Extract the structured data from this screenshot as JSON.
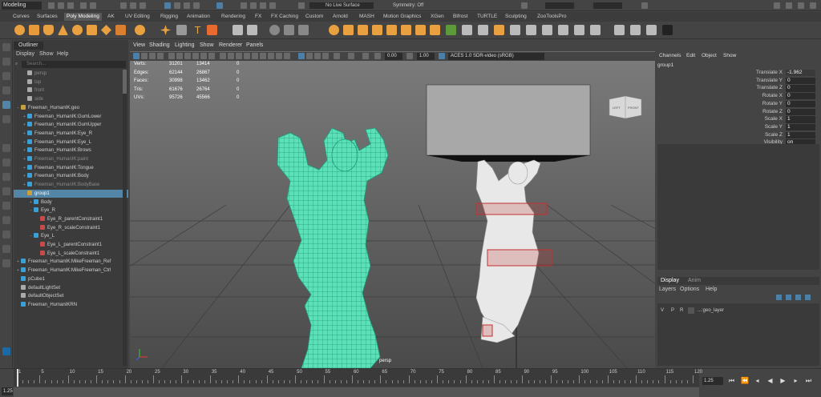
{
  "status": {
    "menuset": "Modeling",
    "surface": "No Live Surface",
    "symmetry": "Symmetry: Off",
    "field1": "",
    "field2": ""
  },
  "shelf_tabs": [
    "Curves",
    "Surfaces",
    "Poly Modeling",
    "AK",
    "UV Editing",
    "Rigging",
    "Animation",
    "Rendering",
    "FX",
    "FX Caching",
    "Custom",
    "Arnold",
    "MASH",
    "Motion Graphics",
    "XGen",
    "Bifrost",
    "TURTLE",
    "Sculpting",
    "ZooToolsPro"
  ],
  "shelf_active": "Poly Modeling",
  "outliner": {
    "title": "Outliner",
    "menu": [
      "Display",
      "Show",
      "Help"
    ],
    "search_placeholder": "Search...",
    "rows": [
      {
        "label": "persp",
        "type": "cam",
        "depth": 1,
        "grey": true
      },
      {
        "label": "top",
        "type": "cam",
        "depth": 1,
        "grey": true
      },
      {
        "label": "front",
        "type": "cam",
        "depth": 1,
        "grey": true
      },
      {
        "label": "side",
        "type": "cam",
        "depth": 1,
        "grey": true
      },
      {
        "label": "Freeman_HumanIK:geo",
        "type": "grp",
        "depth": 0,
        "exp": "−"
      },
      {
        "label": "Freeman_HumanIK:GumLower",
        "type": "mesh",
        "depth": 1,
        "exp": "+"
      },
      {
        "label": "Freeman_HumanIK:GumUpper",
        "type": "mesh",
        "depth": 1,
        "exp": "+"
      },
      {
        "label": "Freeman_HumanIK:Eye_R",
        "type": "mesh",
        "depth": 1,
        "exp": "+"
      },
      {
        "label": "Freeman_HumanIK:Eye_L",
        "type": "mesh",
        "depth": 1,
        "exp": "+"
      },
      {
        "label": "Freeman_HumanIK:Brows",
        "type": "mesh",
        "depth": 1,
        "exp": "+"
      },
      {
        "label": "Freeman_HumanIK:paint",
        "type": "mesh",
        "depth": 1,
        "exp": "+",
        "grey": true
      },
      {
        "label": "Freeman_HumanIK:Tongue",
        "type": "mesh",
        "depth": 1,
        "exp": "+"
      },
      {
        "label": "Freeman_HumanIK:Body",
        "type": "mesh",
        "depth": 1,
        "exp": "+"
      },
      {
        "label": "Freeman_HumanIK:BodyBase",
        "type": "mesh",
        "depth": 1,
        "exp": "+",
        "grey": true
      },
      {
        "label": "group1",
        "type": "grp",
        "depth": 1,
        "exp": "−",
        "sel": true
      },
      {
        "label": "Body",
        "type": "mesh",
        "depth": 2,
        "exp": "+"
      },
      {
        "label": "Eye_R",
        "type": "mesh",
        "depth": 2,
        "exp": "−"
      },
      {
        "label": "Eye_R_parentConstraint1",
        "type": "con",
        "depth": 3
      },
      {
        "label": "Eye_R_scaleConstraint1",
        "type": "con",
        "depth": 3
      },
      {
        "label": "Eye_L",
        "type": "mesh",
        "depth": 2,
        "exp": "−"
      },
      {
        "label": "Eye_L_parentConstraint1",
        "type": "con",
        "depth": 3
      },
      {
        "label": "Eye_L_scaleConstraint1",
        "type": "con",
        "depth": 3
      },
      {
        "label": "Freeman_HumanIK:MikeFreeman_Ref",
        "type": "mesh",
        "depth": 0,
        "exp": "+"
      },
      {
        "label": "Freeman_HumanIK:MikeFreeman_Ctrl",
        "type": "mesh",
        "depth": 0,
        "exp": "+"
      },
      {
        "label": "pCube1",
        "type": "mesh",
        "depth": 0
      },
      {
        "label": "defaultLightSet",
        "type": "set",
        "depth": 0
      },
      {
        "label": "defaultObjectSet",
        "type": "set",
        "depth": 0
      },
      {
        "label": "Freeman_HumanIKRN",
        "type": "mesh",
        "depth": 0
      }
    ]
  },
  "viewport": {
    "menu": [
      "View",
      "Shading",
      "Lighting",
      "Show",
      "Renderer",
      "Panels"
    ],
    "field_a": "0.00",
    "field_b": "1.00",
    "colorspace": "ACES 1.0 SDR-video (sRGB)",
    "hud": [
      {
        "label": "Verts:",
        "a": "31201",
        "b": "13414",
        "c": "0"
      },
      {
        "label": "Edges:",
        "a": "62144",
        "b": "26867",
        "c": "0"
      },
      {
        "label": "Faces:",
        "a": "30998",
        "b": "13462",
        "c": "0"
      },
      {
        "label": "Tris:",
        "a": "61676",
        "b": "26764",
        "c": "0"
      },
      {
        "label": "UVs:",
        "a": "95726",
        "b": "45566",
        "c": "0"
      }
    ],
    "camera": "persp",
    "viewcube": {
      "left": "LEFT",
      "front": "FRONT"
    }
  },
  "channel_box": {
    "tabs": [
      "Channels",
      "Edit",
      "Object",
      "Show"
    ],
    "object": "group1",
    "attrs": [
      {
        "name": "Translate X",
        "value": "-1.962"
      },
      {
        "name": "Translate Y",
        "value": "0"
      },
      {
        "name": "Translate Z",
        "value": "0"
      },
      {
        "name": "Rotate X",
        "value": "0"
      },
      {
        "name": "Rotate Y",
        "value": "0"
      },
      {
        "name": "Rotate Z",
        "value": "0"
      },
      {
        "name": "Scale X",
        "value": "1"
      },
      {
        "name": "Scale Y",
        "value": "1"
      },
      {
        "name": "Scale Z",
        "value": "1"
      },
      {
        "name": "Visibility",
        "value": "on"
      }
    ]
  },
  "layers": {
    "tabs": [
      "Display",
      "Anim"
    ],
    "menu": [
      "Layers",
      "Options",
      "Help"
    ],
    "layer": {
      "v": "V",
      "p": "P",
      "r": "R",
      "name": "...:geo_layer"
    }
  },
  "timeline": {
    "labels": [
      "1",
      "5",
      "10",
      "15",
      "20",
      "25",
      "30",
      "35",
      "40",
      "45",
      "50",
      "55",
      "60",
      "65",
      "70",
      "75",
      "80",
      "85",
      "90",
      "95",
      "100",
      "105",
      "110",
      "115",
      "120"
    ],
    "current": "1.25",
    "start": "1.25"
  },
  "colors": {
    "accent_select": "#5285a6",
    "wire": "#4de3b0",
    "viewport_bg": "#6b6b6b"
  }
}
